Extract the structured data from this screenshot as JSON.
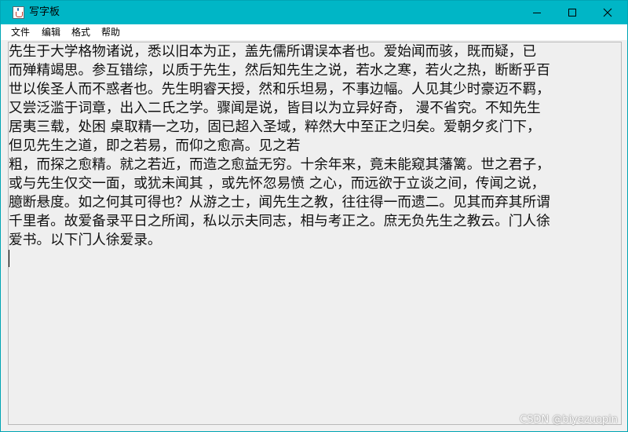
{
  "window": {
    "title": "写字板",
    "app_icon": "java-cup-icon",
    "controls": {
      "minimize_icon": "minimize-icon",
      "maximize_icon": "maximize-icon",
      "close_icon": "close-icon"
    }
  },
  "menu": {
    "items": [
      {
        "label": "文件"
      },
      {
        "label": "编辑"
      },
      {
        "label": "格式"
      },
      {
        "label": "帮助"
      }
    ]
  },
  "editor": {
    "lines": [
      "  先生于大学格物诸说，悉以旧本为正，盖先儒所谓误本者也。爱始闻而骇，既而疑，已",
      "而殚精竭思。参互错综，以质于先生，然后知先生之说，若水之寒，若火之热，断断乎百",
      "世以俟圣人而不惑者也。先生明睿天授，然和乐坦易，不事边幅。人见其少时豪迈不羁，",
      "又尝泛滥于词章，出入二氏之学。骤闻是说，皆目以为立异好奇，  漫不省究。不知先生",
      "居夷三载，处困  桌取精一之功，固已超入圣域，粹然大中至正之归矣。爱朝夕炙门下，",
      "但见先生之道，即之若易，而仰之愈高。见之若",
      "粗，而探之愈精。就之若近，而造之愈益无穷。十余年来，竟未能窥其藩篱。世之君子，",
      "或与先生仅交一面，或犹未闻其  ，或先怀忽易愤  之心，而远欲于立谈之间，传闻之说，",
      "臆断悬度。如之何其可得也？从游之士，闻先生之教，往往得一而遗二。见其而弃其所谓",
      "千里者。故爱备录平日之所闻，私以示夫同志，相与考正之。庶无负先生之教云。门人徐",
      "爱书。以下门人徐爱录。"
    ]
  },
  "watermark": "CSDN @biyezuopin",
  "colors": {
    "titlebar": "#00b6c6",
    "editor_background": "#efefef"
  }
}
